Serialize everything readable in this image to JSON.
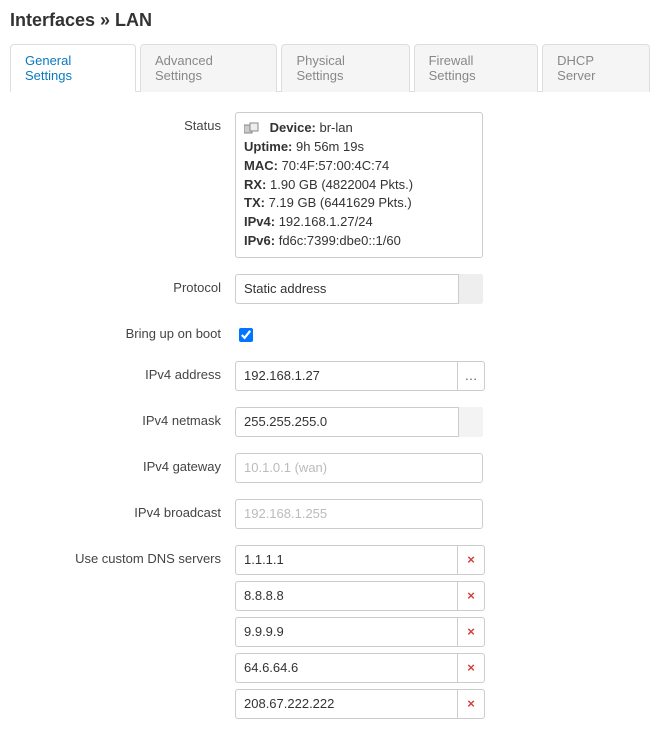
{
  "header": {
    "title": "Interfaces » LAN"
  },
  "tabs": [
    {
      "label": "General Settings",
      "active": true
    },
    {
      "label": "Advanced Settings"
    },
    {
      "label": "Physical Settings"
    },
    {
      "label": "Firewall Settings"
    },
    {
      "label": "DHCP Server"
    }
  ],
  "labels": {
    "status": "Status",
    "protocol": "Protocol",
    "boot": "Bring up on boot",
    "ipv4addr": "IPv4 address",
    "ipv4mask": "IPv4 netmask",
    "ipv4gw": "IPv4 gateway",
    "ipv4bc": "IPv4 broadcast",
    "dns": "Use custom DNS servers"
  },
  "status": {
    "device_label": "Device:",
    "device": "br-lan",
    "uptime_label": "Uptime:",
    "uptime": "9h 56m 19s",
    "mac_label": "MAC:",
    "mac": "70:4F:57:00:4C:74",
    "rx_label": "RX:",
    "rx": "1.90 GB (4822004 Pkts.)",
    "tx_label": "TX:",
    "tx": "7.19 GB (6441629 Pkts.)",
    "ipv4_label": "IPv4:",
    "ipv4": "192.168.1.27/24",
    "ipv6_label": "IPv6:",
    "ipv6": "fd6c:7399:dbe0::1/60"
  },
  "protocol": {
    "selected": "Static address"
  },
  "bring_up_on_boot": true,
  "ipv4": {
    "address": "192.168.1.27",
    "more_btn": "…",
    "netmask": "255.255.255.0",
    "gateway_placeholder": "10.1.0.1 (wan)",
    "broadcast_placeholder": "192.168.1.255"
  },
  "dns_servers": [
    "1.1.1.1",
    "8.8.8.8",
    "9.9.9.9",
    "64.6.64.6",
    "208.67.222.222"
  ],
  "icons": {
    "delete": "×"
  }
}
